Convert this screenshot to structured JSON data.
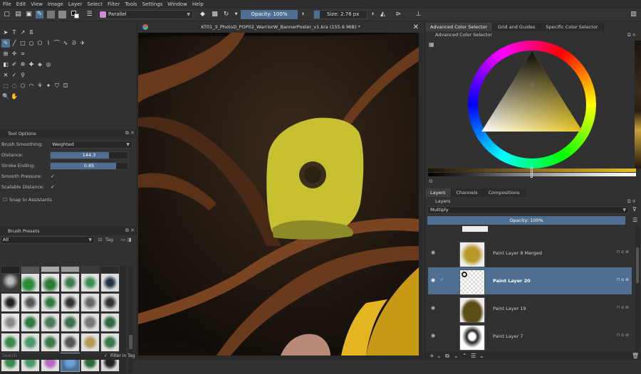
{
  "menu": [
    "File",
    "Edit",
    "View",
    "Image",
    "Layer",
    "Select",
    "Filter",
    "Tools",
    "Settings",
    "Window",
    "Help"
  ],
  "toolbar": {
    "brush_preset_name": "Parallel",
    "opacity_label": "Opacity: 100%",
    "size_label": "Size: 2.76 px"
  },
  "document": {
    "title": "KT01_3_PhotoD_POP02_WarriorW_BannerPoster_v1.kra (155.6 MiB) *"
  },
  "tool_options": {
    "title": "Tool Options",
    "brush_smoothing_label": "Brush Smoothing:",
    "brush_smoothing_value": "Weighted",
    "distance_label": "Distance:",
    "distance_value": "144.3",
    "distance_fraction": 0.76,
    "stroke_ending_label": "Stroke Ending:",
    "stroke_ending_value": "0.85",
    "stroke_ending_fraction": 0.85,
    "smooth_pressure_label": "Smooth Pressure:",
    "scalable_distance_label": "Scalable Distance:",
    "snap_label": "Snap to Assistants"
  },
  "brush_presets": {
    "title": "Brush Presets",
    "filter_value": "All",
    "tag_label": "Tag",
    "filter_in_tag_label": "Filter in Tag",
    "search_placeholder": "Search"
  },
  "color_selector": {
    "tabs": [
      "Advanced Color Selector",
      "Grid and Guides",
      "Specific Color Selector"
    ],
    "panel_title": "Advanced Color Selector",
    "current_color": "#e5c21d"
  },
  "layers": {
    "tabs": [
      "Layers",
      "Channels",
      "Compositions"
    ],
    "panel_title": "Layers",
    "blend_mode": "Multiply",
    "opacity_label": "Opacity:  100%",
    "items": [
      {
        "name": "Paint Layer 8 Merged",
        "selected": false
      },
      {
        "name": "Paint Layer 20",
        "selected": true
      },
      {
        "name": "Paint Layer 19",
        "selected": false
      },
      {
        "name": "Paint Layer 7",
        "selected": false
      }
    ]
  },
  "colors": {
    "accent": "#4e6f92",
    "panel_bg": "#313131"
  }
}
